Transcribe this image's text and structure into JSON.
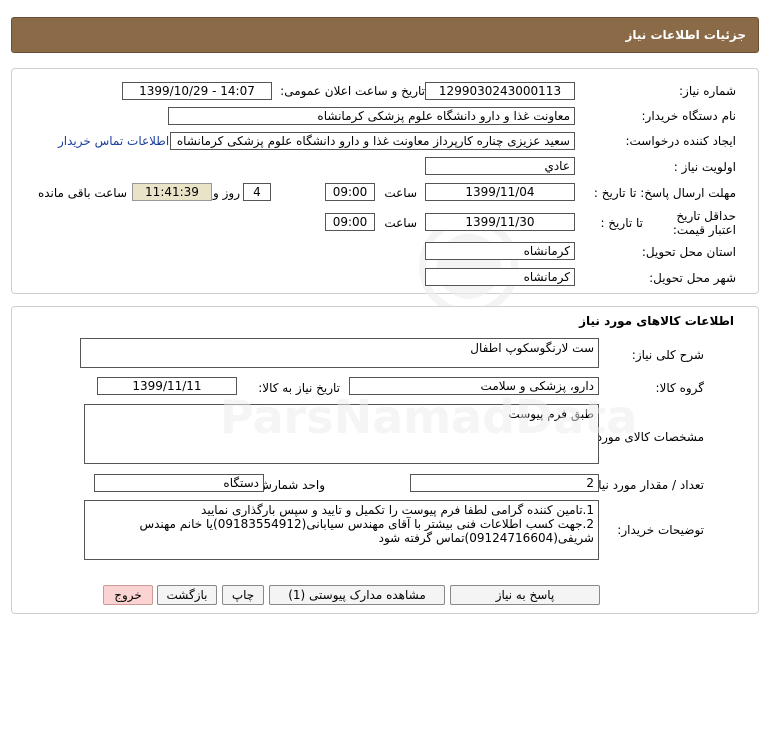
{
  "header": {
    "title": "جزئیات اطلاعات نیاز"
  },
  "info": {
    "need_number_label": "شماره نیاز:",
    "need_number": "1299030243000113",
    "announce_label": "تاریخ و ساعت اعلان عمومی:",
    "announce_value": "1399/10/29 - 14:07",
    "buyer_org_label": "نام دستگاه خریدار:",
    "buyer_org": "معاونت غذا و دارو دانشگاه علوم پزشکی کرمانشاه",
    "requester_label": "ایجاد کننده درخواست:",
    "requester": "سعید عزیزی چناره کارپرداز معاونت غذا و دارو دانشگاه علوم پزشکی کرمانشاه",
    "contact_link": "اطلاعات تماس خریدار",
    "priority_label": "اولویت نیاز :",
    "priority": "عادي",
    "deadline_label": "مهلت ارسال پاسخ:  تا تاریخ :",
    "deadline_date": "1399/11/04",
    "time_label": "ساعت",
    "deadline_time": "09:00",
    "days": "4",
    "days_label": "روز و",
    "remaining_time": "11:41:39",
    "remaining_label": "ساعت باقی مانده",
    "validity_label": "حداقل تاریخ اعتبار قیمت:",
    "validity_to_label": "تا تاریخ :",
    "validity_date": "1399/11/30",
    "validity_time": "09:00",
    "province_label": "استان محل تحویل:",
    "province": "کرمانشاه",
    "city_label": "شهر محل تحویل:",
    "city": "کرمانشاه"
  },
  "goods": {
    "title": "اطلاعات کالاهای مورد نیاز",
    "summary_label": "شرح کلی نیاز:",
    "summary": "ست لارنگوسکوپ اطفال",
    "group_label": "گروه کالا:",
    "group": "دارو، پزشکی و سلامت",
    "need_date_label": "تاریخ نیاز به کالا:",
    "need_date": "1399/11/11",
    "specs_label": "مشخصات کالای مورد نیاز:",
    "specs": "طبق فرم پیوست",
    "qty_label": "تعداد / مقدار مورد نیاز:",
    "qty": "2",
    "unit_label": "واحد شمارش:",
    "unit": "دستگاه",
    "notes_label": "توضیحات خریدار:",
    "notes_line1": "1.تامین کننده گرامی لطفا فرم پیوست را تکمیل و تایید و سپس بارگذاری نمایید",
    "notes_line2": "2.جهت کسب اطلاعات فنی بیشتر با آقای مهندس سیابانی(09183554912)یا خانم مهندس شریفی(09124716604)تماس گرفته شود"
  },
  "actions": {
    "reply": "پاسخ به نیاز",
    "attachments": "مشاهده مدارک پیوستی (1)",
    "print": "چاپ",
    "back": "بازگشت",
    "exit": "خروج"
  }
}
